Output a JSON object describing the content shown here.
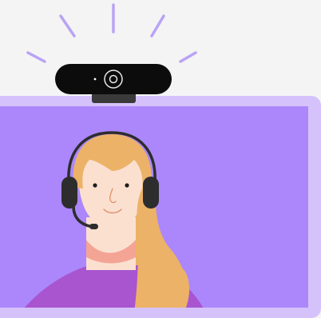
{
  "scene": {
    "subject": "person-with-headset-on-video-call",
    "icons": [
      "webcam-icon",
      "headset-icon",
      "microphone-icon",
      "light-rays-icon"
    ]
  },
  "colors": {
    "background": "#f4f4f4",
    "monitor_frame": "#d6c2fb",
    "screen": "#ab87fb",
    "webcam_body": "#0c0c0c",
    "webcam_stand": "#3a3a3a",
    "rays": "#b9a3f5",
    "hair": "#ecb268",
    "skin": "#fbe0d0",
    "neck_shadow": "#f4a494",
    "shirt": "#a955cf",
    "headset": "#2d2d2d"
  }
}
